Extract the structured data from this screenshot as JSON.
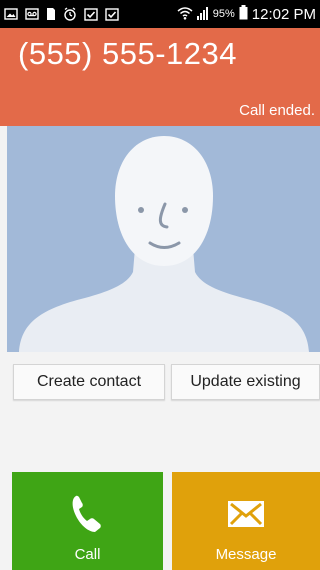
{
  "status_bar": {
    "battery_percent": "95%",
    "time": "12:02 PM"
  },
  "call": {
    "number": "(555) 555-1234",
    "status": "Call ended."
  },
  "buttons": {
    "create_contact": "Create contact",
    "update_existing": "Update existing"
  },
  "actions": {
    "call_label": "Call",
    "message_label": "Message"
  },
  "colors": {
    "header": "#e36a49",
    "photo_bg": "#a2b9d8",
    "call": "#3fa515",
    "message": "#e0a10b"
  }
}
